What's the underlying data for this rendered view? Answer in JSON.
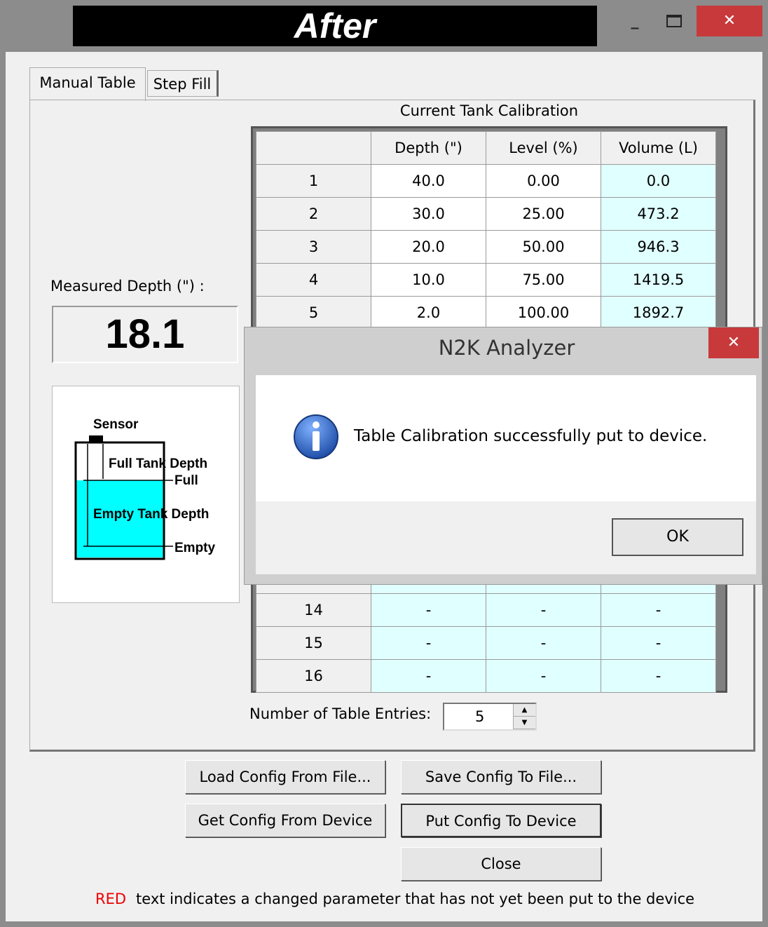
{
  "window": {
    "title": "After",
    "controls": {
      "minimize": "_",
      "close": "✕"
    }
  },
  "tabs": [
    {
      "label": "Manual Table",
      "selected": true
    },
    {
      "label": "Step Fill",
      "selected": false
    }
  ],
  "calibration": {
    "caption": "Current Tank Calibration",
    "columns": [
      "",
      "Depth (\")",
      "Level (%)",
      "Volume (L)"
    ],
    "rows": [
      [
        "1",
        "40.0",
        "0.00",
        "0.0"
      ],
      [
        "2",
        "30.0",
        "25.00",
        "473.2"
      ],
      [
        "3",
        "20.0",
        "50.00",
        "946.3"
      ],
      [
        "4",
        "10.0",
        "75.00",
        "1419.5"
      ],
      [
        "5",
        "2.0",
        "100.00",
        "1892.7"
      ],
      [
        "14",
        "-",
        "-",
        "-"
      ],
      [
        "15",
        "-",
        "-",
        "-"
      ],
      [
        "16",
        "-",
        "-",
        "-"
      ]
    ]
  },
  "measured": {
    "label": "Measured Depth (\") :",
    "value": "18.1"
  },
  "diagram": {
    "sensor": "Sensor",
    "full_tank_depth": "Full Tank Depth",
    "full": "Full",
    "empty_tank_depth": "Empty Tank Depth",
    "empty": "Empty",
    "fill_color": "#00ffff"
  },
  "entries": {
    "label": "Number of Table Entries:",
    "value": "5"
  },
  "buttons": {
    "load": "Load Config From File...",
    "save": "Save Config To File...",
    "get": "Get Config From Device",
    "put": "Put Config To Device",
    "close": "Close"
  },
  "footnote": {
    "red_word": "RED",
    "text": "text indicates a changed parameter that has not yet been put to the device"
  },
  "dialog": {
    "title": "N2K Analyzer",
    "message": "Table Calibration successfully put to device.",
    "ok": "OK",
    "close": "✕",
    "icon": "info-icon"
  },
  "colors": {
    "close_red": "#c7393b",
    "cell_cyan": "#e0ffff",
    "footnote_red": "#ee0000",
    "info_blue": "#1f5fbf"
  }
}
